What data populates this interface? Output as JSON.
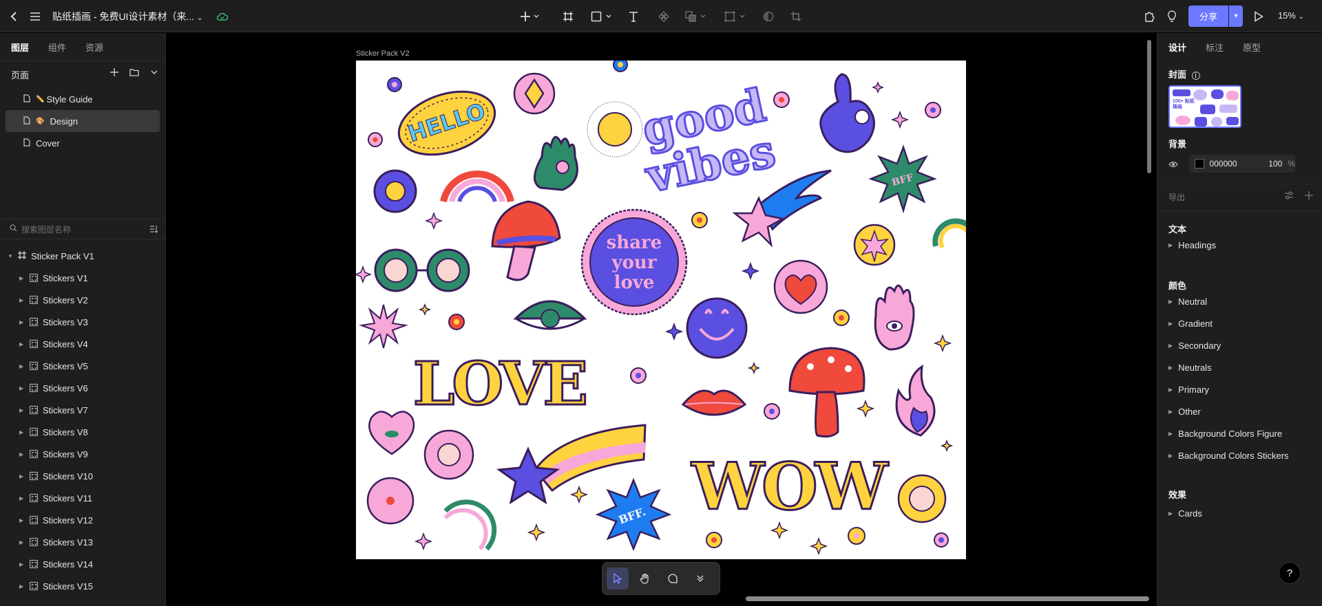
{
  "topbar": {
    "title": "贴纸插画 - 免费UI设计素材（来...",
    "share_label": "分享",
    "zoom": "15%"
  },
  "left_panel": {
    "tabs": [
      "图层",
      "组件",
      "资源"
    ],
    "pages_label": "页面",
    "pages": [
      {
        "label": "Style Guide",
        "emoji": "✏️"
      },
      {
        "label": "Design",
        "emoji": "🎨"
      },
      {
        "label": "Cover",
        "emoji": ""
      }
    ],
    "search_placeholder": "搜索图层名称",
    "root_layer": "Sticker Pack V1",
    "layers": [
      "Stickers V1",
      "Stickers V2",
      "Stickers V3",
      "Stickers V4",
      "Stickers V5",
      "Stickers V6",
      "Stickers V7",
      "Stickers V8",
      "Stickers V9",
      "Stickers V10",
      "Stickers V11",
      "Stickers V12",
      "Stickers V13",
      "Stickers V14",
      "Stickers V15"
    ]
  },
  "canvas": {
    "frame_label": "Sticker Pack V2",
    "stickers": {
      "hello": "HELLO",
      "good": "good",
      "vibes": "vibes",
      "share": "share",
      "your": "your",
      "love_small": "love",
      "love_big": "LOVE",
      "wow": "WOW",
      "bff1": "BFF",
      "bff2": "BFF."
    }
  },
  "right_panel": {
    "tabs": [
      "设计",
      "标注",
      "原型"
    ],
    "cover_label": "封面",
    "cover_thumb_text": "100+ 贴纸插画",
    "background_label": "背景",
    "bg_hex": "000000",
    "bg_opacity": "100",
    "bg_unit": "%",
    "export_label": "导出",
    "text_label": "文本",
    "text_styles": [
      "Headings"
    ],
    "color_label": "颜色",
    "color_styles": [
      "Neutral",
      "Gradient",
      "Secondary",
      "Neutrals",
      "Primary",
      "Other",
      "Background Colors Figure",
      "Background Colors Stickers"
    ],
    "effect_label": "效果",
    "effect_styles": [
      "Cards"
    ]
  },
  "help_label": "?",
  "colors": {
    "accent": "#6b78ff",
    "yellow": "#ffd23f",
    "pink": "#f7a8d8",
    "purple": "#5a4fe0",
    "green": "#2e8b6a",
    "red": "#ef4a3c",
    "blue": "#1f7bf0"
  }
}
